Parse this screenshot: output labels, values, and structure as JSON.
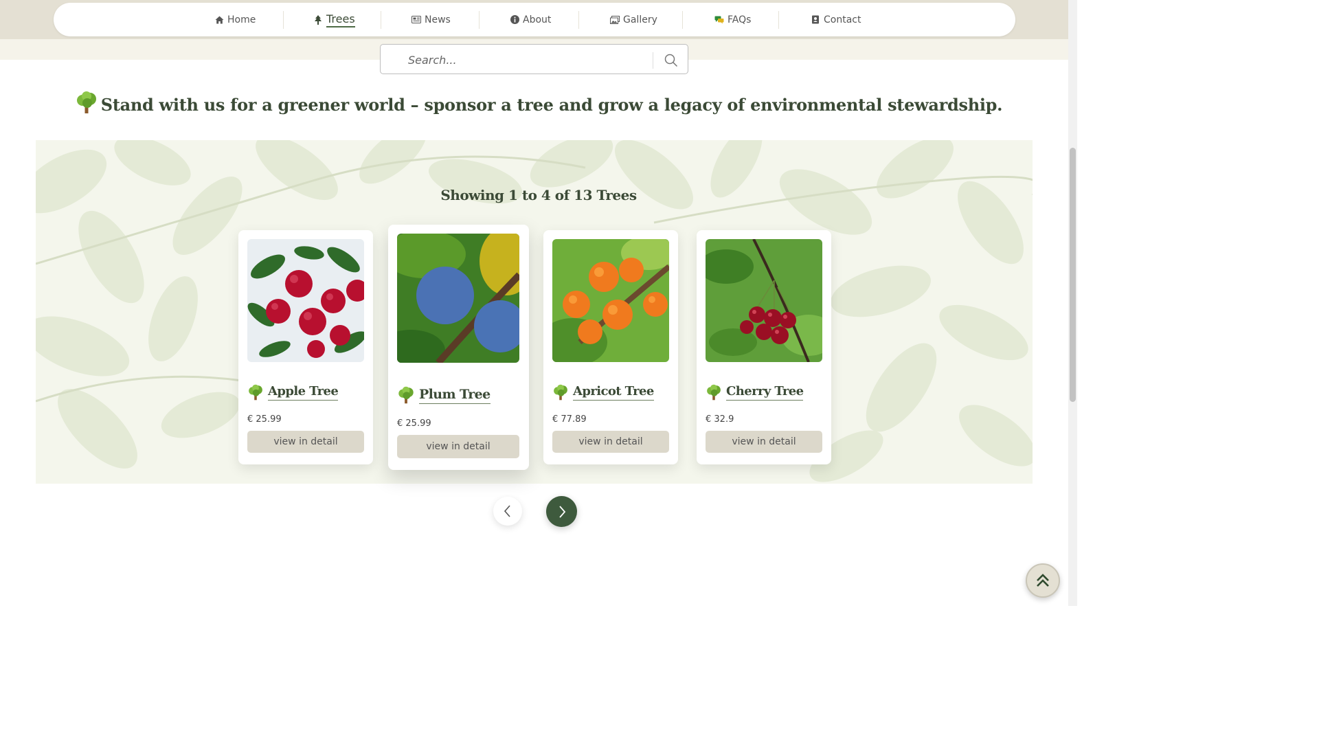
{
  "nav": {
    "items": [
      {
        "label": "Home",
        "icon": "home-icon"
      },
      {
        "label": "Trees",
        "icon": "tree-icon",
        "active": true
      },
      {
        "label": "News",
        "icon": "newspaper-icon"
      },
      {
        "label": "About",
        "icon": "info-icon"
      },
      {
        "label": "Gallery",
        "icon": "images-icon"
      },
      {
        "label": "FAQs",
        "icon": "comments-icon"
      },
      {
        "label": "Contact",
        "icon": "address-book-icon"
      }
    ]
  },
  "search": {
    "placeholder": "Search..."
  },
  "tagline": "Stand with us for a greener world – sponsor a tree and grow a legacy of environmental stewardship.",
  "listing": {
    "showing_text": "Showing 1 to 4 of 13 Trees"
  },
  "cards": [
    {
      "name": "Apple Tree",
      "price": "€ 25.99",
      "button": "view in detail",
      "fruit": "apple"
    },
    {
      "name": "Plum Tree",
      "price": "€ 25.99",
      "button": "view in detail",
      "fruit": "plum"
    },
    {
      "name": "Apricot Tree",
      "price": "€ 77.89",
      "button": "view in detail",
      "fruit": "apricot"
    },
    {
      "name": "Cherry Tree",
      "price": "€ 32.9",
      "button": "view in detail",
      "fruit": "cherry"
    }
  ],
  "colors": {
    "brand_dark_green": "#3e5a3d",
    "nav_band": "#e4e0d3",
    "button_beige": "#dcd8cb",
    "heading_text": "#3b4a36"
  }
}
